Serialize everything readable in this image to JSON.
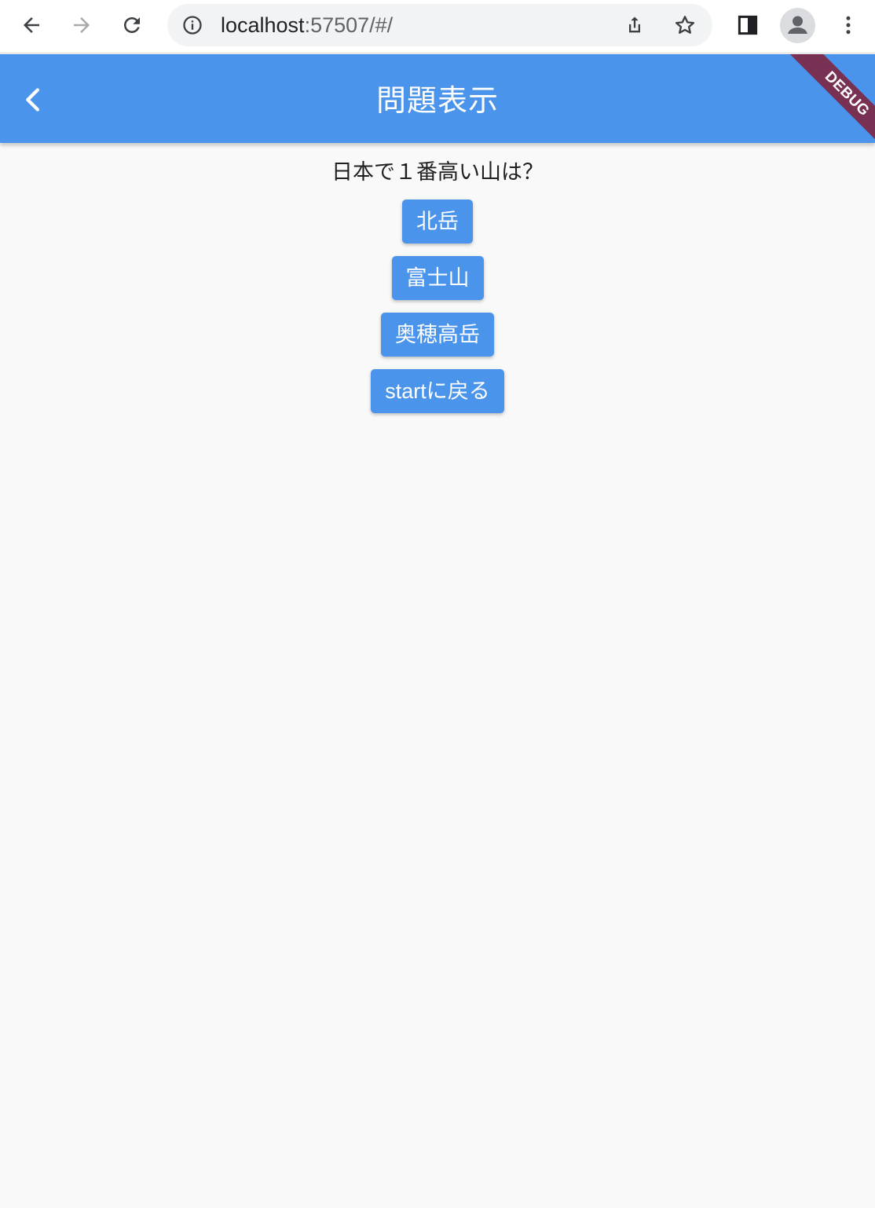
{
  "browser": {
    "url_host": "localhost",
    "url_rest": ":57507/#/",
    "icons": {
      "back": "arrow-left-icon",
      "forward": "arrow-right-icon",
      "reload": "reload-icon",
      "info": "info-icon",
      "share": "share-icon",
      "bookmark": "star-icon",
      "side_panel": "side-panel-icon",
      "profile": "profile-icon",
      "menu": "kebab-menu-icon"
    }
  },
  "appbar": {
    "title": "問題表示",
    "debug_label": "DEBUG",
    "color": "#4a94eb"
  },
  "quiz": {
    "question": "日本で１番高い山は？",
    "answers": [
      {
        "label": "北岳"
      },
      {
        "label": "富士山"
      },
      {
        "label": "奥穂高岳"
      }
    ],
    "back_to_start_label": "startに戻る"
  }
}
